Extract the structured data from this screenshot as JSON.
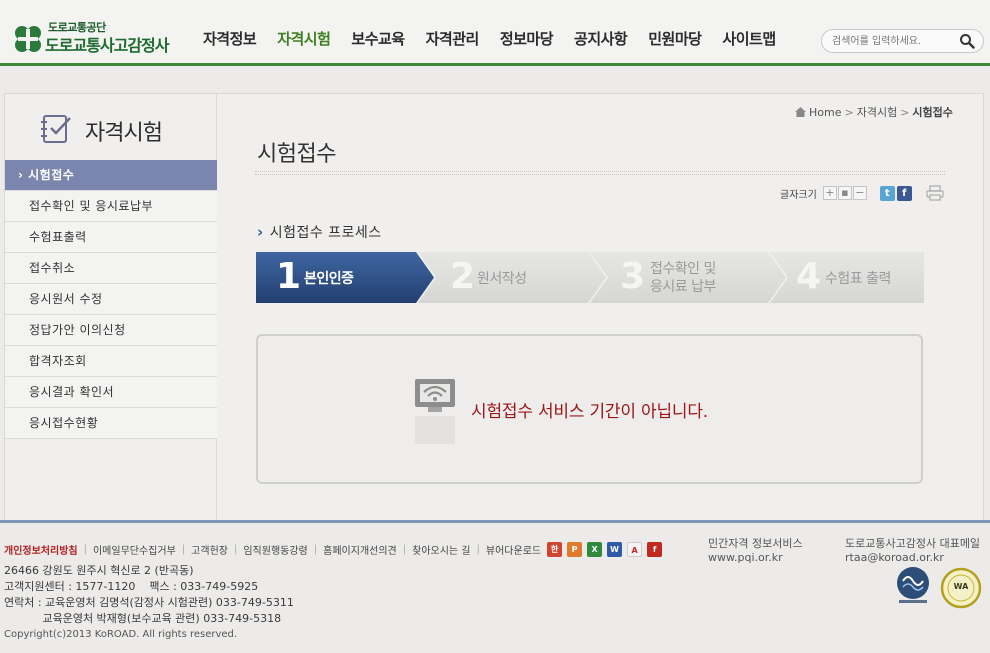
{
  "header": {
    "org_name": "도로교통공단",
    "site_title": "도로교통사고감정사",
    "nav": [
      "자격정보",
      "자격시험",
      "보수교육",
      "자격관리",
      "정보마당",
      "공지사항",
      "민원마당",
      "사이트맵"
    ],
    "active_nav_index": 1,
    "search_placeholder": "검색어를 입력하세요."
  },
  "sidebar": {
    "title": "자격시험",
    "items": [
      {
        "label": "시험접수",
        "active": true
      },
      {
        "label": "접수확인 및 응시료납부"
      },
      {
        "label": "수험표출력"
      },
      {
        "label": "접수취소"
      },
      {
        "label": "응시원서 수정"
      },
      {
        "label": "정답가안 이의신청"
      },
      {
        "label": "합격자조회"
      },
      {
        "label": "응시결과 확인서"
      },
      {
        "label": "응시접수현황"
      }
    ]
  },
  "breadcrumb": {
    "home": "Home",
    "section": "자격시험",
    "current": "시험접수"
  },
  "main": {
    "page_title": "시험접수",
    "font_size_label": "글자크기",
    "process_title": "시험접수 프로세스",
    "steps": [
      {
        "num": "1",
        "label": "본인인증",
        "active": true
      },
      {
        "num": "2",
        "label": "원서작성"
      },
      {
        "num": "3",
        "label_line1": "접수확인 및",
        "label_line2": "응시료 납부"
      },
      {
        "num": "4",
        "label": "수험표 출력"
      }
    ],
    "notice": "시험접수 서비스 기간이 아닙니다."
  },
  "footer": {
    "links": [
      "개인정보처리방침",
      "이메일무단수집거부",
      "고객헌장",
      "임직원행동강령",
      "홈페이지개선의견",
      "찾아오시는 길",
      "뷰어다운로드"
    ],
    "address_lines": [
      "26466 강원도 원주시 혁신로 2 (반곡동)",
      "고객지원센터 : 1577-1120    팩스 : 033-749-5925",
      "연락처 : 교육운영처 김명석(감정사 시험관련) 033-749-5311",
      "           교육운영처 박재형(보수교육 관련) 033-749-5318"
    ],
    "copyright": "Copyright(c)2013 KoROAD. All rights reserved.",
    "private_service_title": "민간자격 정보서비스",
    "private_service_url": "www.pqi.or.kr",
    "email_title": "도로교통사고감정사 대표메일",
    "email": "rtaa@koroad.or.kr"
  },
  "colors": {
    "accent_green": "#3d8a3d",
    "step_active": "#2b4f86",
    "notice_red": "#9b1515",
    "sidebar_active": "#7a86ad"
  }
}
